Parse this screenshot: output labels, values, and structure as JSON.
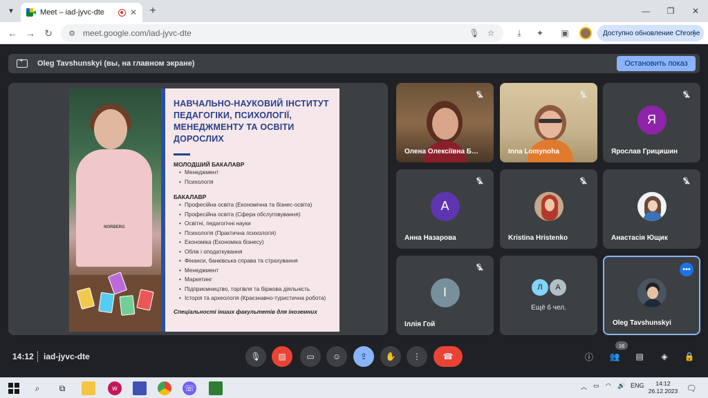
{
  "browser": {
    "tab_title": "Meet – iad-jyvc-dte",
    "tab_close": "✕",
    "new_tab": "+",
    "url": "meet.google.com/iad-jyvc-dte",
    "update_label": "Доступно обновление Chrome"
  },
  "banner": {
    "text": "Oleg Tavshunskyi (вы, на главном экране)",
    "stop_label": "Остановить показ"
  },
  "slide": {
    "title": "НАВЧАЛЬНО-НАУКОВИЙ ІНСТИТУТ ПЕДАГОГІКИ, ПСИХОЛОГІЇ, МЕНЕДЖМЕНТУ ТА ОСВІТИ ДОРОСЛИХ",
    "section1_head": "МОЛОДШИЙ БАКАЛАВР",
    "section1_items": [
      "Менеджмент",
      "Психологія"
    ],
    "section2_head": "БАКАЛАВР",
    "section2_items": [
      "Професійна освіта (Економічна та бізнес-освіта)",
      "Професійна освіта (Сфера обслуговування)",
      "Освітні, педагогічні науки",
      "Психологія (Практична психологія)",
      "Економіка (Економіка бізнесу)",
      "Облік і оподаткування",
      "Фінанси, банківська справа та страхування",
      "Менеджмент",
      "Маркетинг",
      "Підприємництво, торгівля та біржова діяльність",
      "Історія та археологія (Краєзнавчо-туристична робота)"
    ],
    "footer": "Спеціальності інших факультетів для іноземних",
    "shirt_logo": "NORBERG"
  },
  "participants": [
    {
      "name": "Олена Олексіївна Б…",
      "type": "video-a"
    },
    {
      "name": "Inna Lomynoha",
      "type": "video-b"
    },
    {
      "name": "Ярослав Грицишин",
      "initial": "Я",
      "color": "#8e24aa"
    },
    {
      "name": "Анна Назарова",
      "initial": "А",
      "color": "#5e35b1"
    },
    {
      "name": "Kristina Hristenko",
      "type": "photo"
    },
    {
      "name": "Анастасія Ющик",
      "type": "photo"
    },
    {
      "name": "Іллія Гой",
      "initial": "І",
      "color": "#78909c"
    },
    {
      "more_text": "Ещё 6 чел.",
      "initials": [
        "Л",
        "А"
      ],
      "colors": [
        "#81d4fa",
        "#b0bec5"
      ]
    },
    {
      "name": "Oleg Tavshunskyi",
      "type": "photo",
      "self": true
    }
  ],
  "more_dots": "•••",
  "bottom": {
    "time": "14:12",
    "meeting_code": "iad-jyvc-dte",
    "people_count": "16"
  },
  "taskbar": {
    "lang": "ENG",
    "clock_time": "14:12",
    "clock_date": "26.12.2023"
  },
  "colors": {
    "accent": "#8ab4f8",
    "danger": "#ea4335",
    "surface": "#3c4043",
    "background": "#202124"
  }
}
